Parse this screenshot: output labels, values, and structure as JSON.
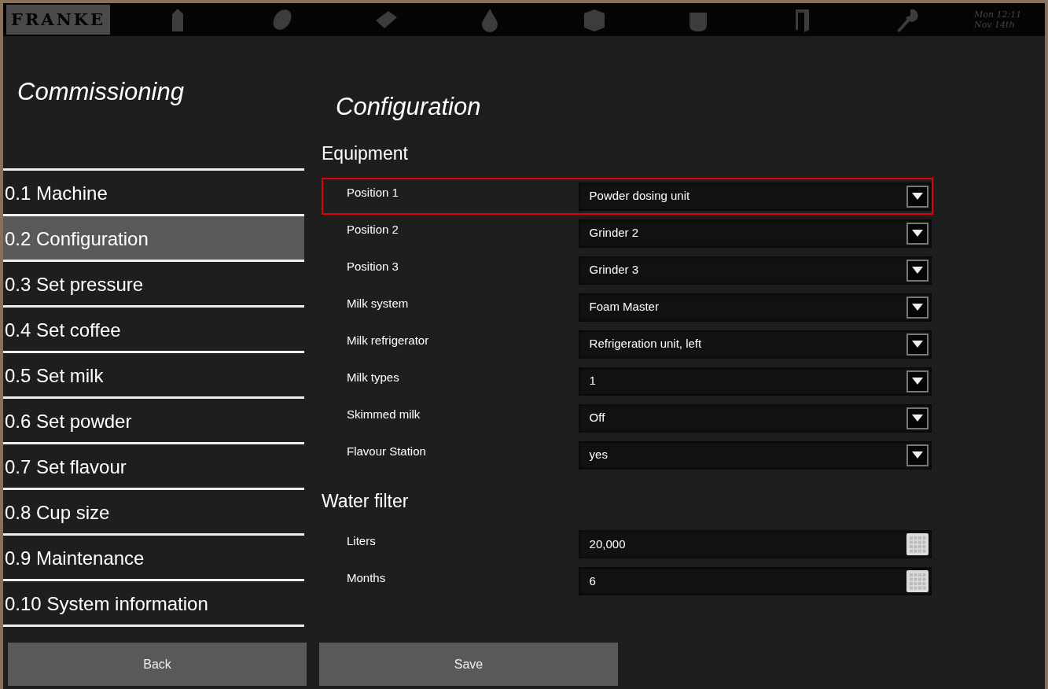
{
  "top_bar": {
    "logo": "FRANKE",
    "datetime": [
      "Mon 12:11",
      "Nov 14th"
    ]
  },
  "sidebar": {
    "title": "Commissioning",
    "items": [
      {
        "label": "0.1 Machine",
        "selected": false
      },
      {
        "label": "0.2 Configuration",
        "selected": true
      },
      {
        "label": "0.3 Set pressure",
        "selected": false
      },
      {
        "label": "0.4 Set coffee",
        "selected": false
      },
      {
        "label": "0.5 Set milk",
        "selected": false
      },
      {
        "label": "0.6 Set powder",
        "selected": false
      },
      {
        "label": "0.7 Set flavour",
        "selected": false
      },
      {
        "label": "0.8 Cup size",
        "selected": false
      },
      {
        "label": "0.9 Maintenance",
        "selected": false
      },
      {
        "label": "0.10 System information",
        "selected": false
      }
    ]
  },
  "content": {
    "title": "Configuration",
    "sections": [
      {
        "heading": "Equipment",
        "rows": [
          {
            "label": "Position 1",
            "value": "Powder dosing unit",
            "kind": "dropdown",
            "highlighted": true
          },
          {
            "label": "Position 2",
            "value": "Grinder 2",
            "kind": "dropdown",
            "highlighted": false
          },
          {
            "label": "Position 3",
            "value": "Grinder 3",
            "kind": "dropdown",
            "highlighted": false
          },
          {
            "label": "Milk system",
            "value": "Foam Master",
            "kind": "dropdown",
            "highlighted": false
          },
          {
            "label": "Milk refrigerator",
            "value": "Refrigeration unit, left",
            "kind": "dropdown",
            "highlighted": false
          },
          {
            "label": "Milk types",
            "value": "1",
            "kind": "dropdown",
            "highlighted": false
          },
          {
            "label": "Skimmed milk",
            "value": "Off",
            "kind": "dropdown",
            "highlighted": false
          },
          {
            "label": "Flavour Station",
            "value": "yes",
            "kind": "dropdown",
            "highlighted": false
          }
        ]
      },
      {
        "heading": "Water filter",
        "rows": [
          {
            "label": "Liters",
            "value": "20,000",
            "kind": "keypad",
            "highlighted": false
          },
          {
            "label": "Months",
            "value": "6",
            "kind": "keypad",
            "highlighted": false
          }
        ]
      }
    ]
  },
  "buttons": [
    "Back",
    "Save"
  ]
}
